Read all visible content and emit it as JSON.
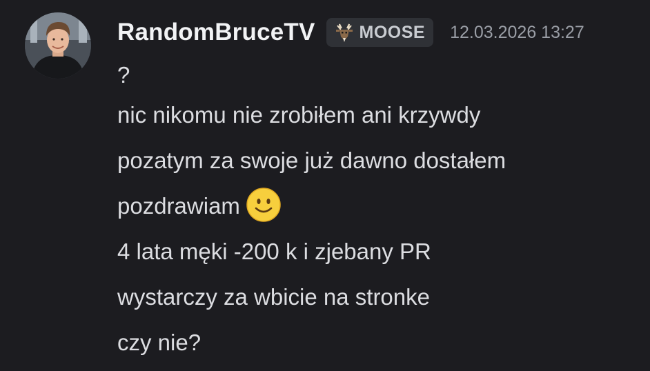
{
  "message": {
    "username": "RandomBruceTV",
    "tag": {
      "icon": "goat-icon",
      "label": "MOOSE"
    },
    "timestamp": "12.03.2026 13:27",
    "lines": [
      "?",
      "nic nikomu nie zrobiłem ani krzywdy",
      "pozatym za swoje już dawno dostałem",
      "pozdrawiam",
      "4 lata męki -200 k i zjebany PR",
      "wystarczy za wbicie na stronke",
      "czy nie?"
    ],
    "emoji": "slightly-smiling-face-icon"
  },
  "colors": {
    "background": "#1c1c20",
    "username": "#f2f3f5",
    "text": "#dcdde1",
    "timestamp": "#9a9ea6",
    "tag_bg": "#2f3136"
  }
}
